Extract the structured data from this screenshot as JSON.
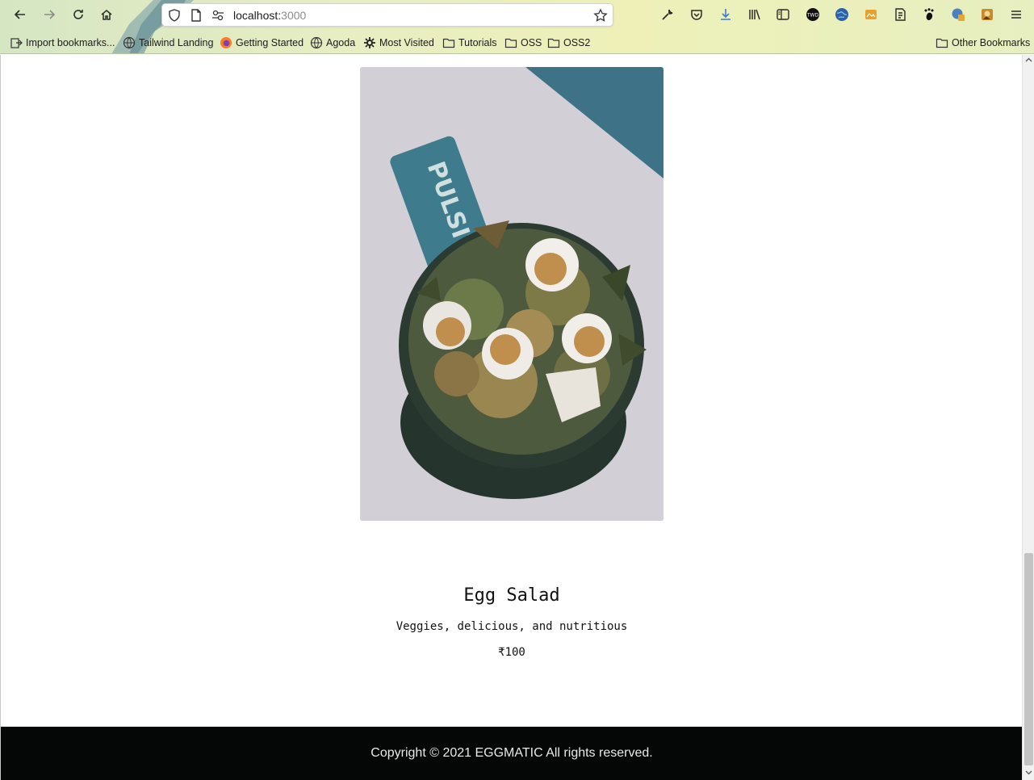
{
  "browser": {
    "url_host": "localhost:",
    "url_port": "3000",
    "bookmarks": [
      {
        "label": "Import bookmarks...",
        "icon": "import-icon"
      },
      {
        "label": "Tailwind Landing",
        "icon": "globe-icon"
      },
      {
        "label": "Getting Started",
        "icon": "firefox-icon"
      },
      {
        "label": "Agoda",
        "icon": "globe-icon"
      },
      {
        "label": "Most Visited",
        "icon": "gear-icon"
      },
      {
        "label": "Tutorials",
        "icon": "folder-icon"
      },
      {
        "label": "OSS",
        "icon": "folder-icon"
      },
      {
        "label": "OSS2",
        "icon": "folder-icon"
      }
    ],
    "other_bookmarks": "Other Bookmarks"
  },
  "product": {
    "image_text": "PULSITO",
    "name": "Egg Salad",
    "description": "Veggies, delicious, and nutritious",
    "price": "₹100"
  },
  "footer": {
    "copyright": "Copyright © 2021 EGGMATIC All rights reserved."
  },
  "colors": {
    "footer_bg": "#040706",
    "image_bg": "#d2d0d6",
    "toolbar_bg": "#e8eec2"
  }
}
